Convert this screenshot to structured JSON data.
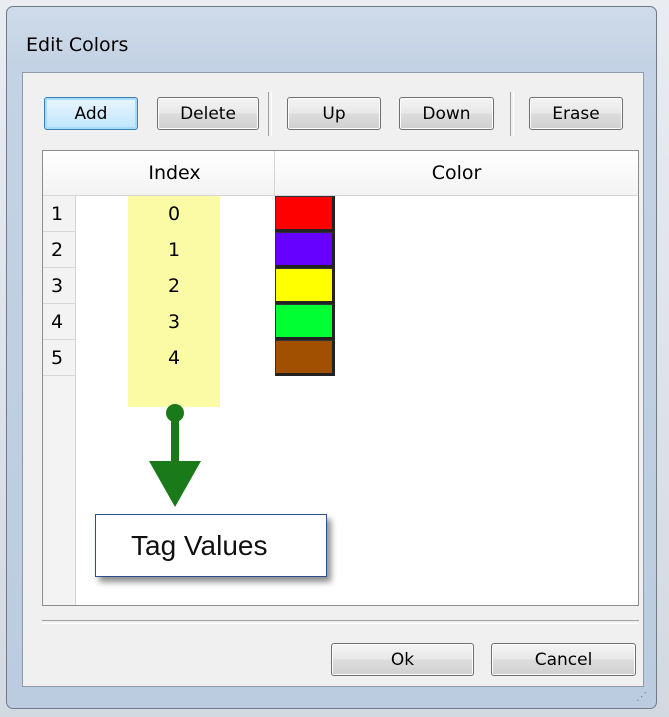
{
  "dialog": {
    "title": "Edit Colors"
  },
  "toolbar": {
    "add_label": "Add",
    "delete_label": "Delete",
    "up_label": "Up",
    "down_label": "Down",
    "erase_label": "Erase"
  },
  "grid": {
    "columns": [
      "Index",
      "Color"
    ],
    "rows": [
      {
        "row": "1",
        "index": "0",
        "color": "#ff0000"
      },
      {
        "row": "2",
        "index": "1",
        "color": "#6600ff"
      },
      {
        "row": "3",
        "index": "2",
        "color": "#ffff00"
      },
      {
        "row": "4",
        "index": "3",
        "color": "#00ff33"
      },
      {
        "row": "5",
        "index": "4",
        "color": "#a05000"
      }
    ]
  },
  "annotation": {
    "label": "Tag Values",
    "highlight_color": "#fafa96",
    "arrow_color": "#1a7a1a"
  },
  "footer": {
    "ok_label": "Ok",
    "cancel_label": "Cancel"
  }
}
